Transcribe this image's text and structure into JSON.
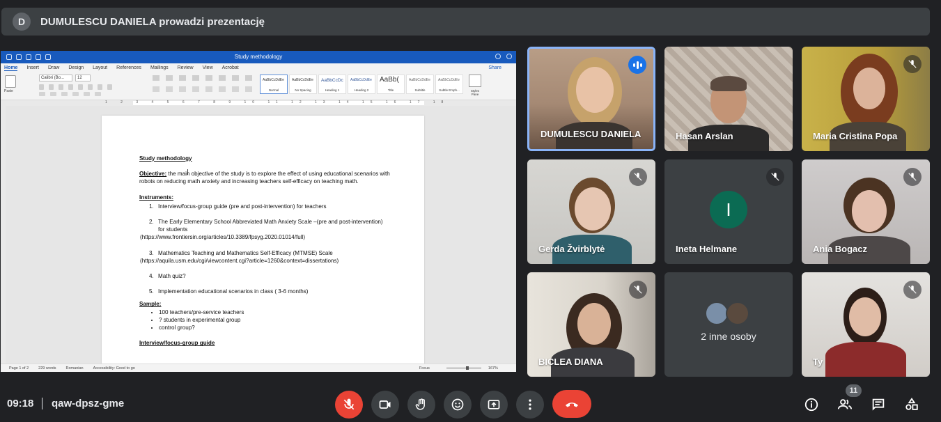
{
  "presenting_bar": {
    "avatar_letter": "D",
    "text": "DUMULESCU DANIELA prowadzi prezentację"
  },
  "word": {
    "title": "Study methodology",
    "tabs": [
      "Home",
      "Insert",
      "Draw",
      "Design",
      "Layout",
      "References",
      "Mailings",
      "Review",
      "View",
      "Acrobat"
    ],
    "share_label": "Share",
    "paste_label": "Paste",
    "font_name": "Calibri (Bo...",
    "font_size": "12",
    "styles": [
      {
        "sample": "AaBbCcDdEe",
        "name": "Normal"
      },
      {
        "sample": "AaBbCcDdEe",
        "name": "No Spacing"
      },
      {
        "sample": "AaBbCcDc",
        "name": "Heading 1"
      },
      {
        "sample": "AaBbCcDdEe",
        "name": "Heading 2"
      },
      {
        "sample": "AaBb(",
        "name": "Title"
      },
      {
        "sample": "AaBbCcDdEe",
        "name": "Subtitle"
      },
      {
        "sample": "AaBbCcDdEe",
        "name": "Subtle Emph..."
      }
    ],
    "styles_pane_label": "Styles Pane",
    "ruler_numbers": "1 2 3 4 5 6 7 8 9 10 11 12 13 14 15 16 17 18",
    "doc": {
      "heading": "Study methodology",
      "objective_label": "Objective:",
      "objective_text": " the main objective of the study is to explore the effect of using educational scenarios with robots on reducing math anxiety and increasing teachers self-efficacy on teaching math.",
      "instruments_label": "Instruments:",
      "item1": "Interview/focus-group guide (pre and post-intervention) for teachers",
      "item2a": "The Early Elementary School Abbreviated Math Anxiety Scale –(pre and post-intervention)",
      "item2b": "for students",
      "item2c": "(https://www.frontiersin.org/articles/10.3389/fpsyg.2020.01014/full)",
      "item3a": "Mathematics Teaching and Mathematics Self-Efficacy (MTMSE) Scale",
      "item3b": "(https://aquila.usm.edu/cgi/viewcontent.cgi?article=1260&context=dissertations)",
      "item4": "Math quiz?",
      "item5": "Implementation educational scenarios in class ( 3-6 months)",
      "sample_label": "Sample:",
      "sample1": "100 teachers/pre-service teachers",
      "sample2": "? students in experimental group",
      "sample3": "control group?",
      "interview_label": "Interview/focus-group guide",
      "num1": "1.",
      "num2": "2.",
      "num3": "3.",
      "num4": "4.",
      "num5": "5."
    },
    "status": {
      "page": "Page 1 of 2",
      "words": "229 words",
      "language": "Romanian",
      "accessibility": "Accessibility: Good to go",
      "focus": "Focus",
      "zoom": "167%"
    }
  },
  "participants": [
    {
      "name": "DUMULESCU DANIELA",
      "speaking": true
    },
    {
      "name": "Hasan Arslan",
      "muted": false
    },
    {
      "name": "Maria Cristina Popa",
      "muted": true
    },
    {
      "name": "Gerda Žvirblytė",
      "muted": true
    },
    {
      "name": "Ineta Helmane",
      "muted": true,
      "avatar_letter": "I"
    },
    {
      "name": "Ania Bogacz",
      "muted": true
    },
    {
      "name": "BICLEA DIANA",
      "muted": true
    },
    {
      "name": "2 inne osoby"
    },
    {
      "name": "Ty",
      "muted": true
    }
  ],
  "bottom": {
    "time": "09:18",
    "meeting_code": "qaw-dpsz-gme",
    "participant_count": "11"
  }
}
